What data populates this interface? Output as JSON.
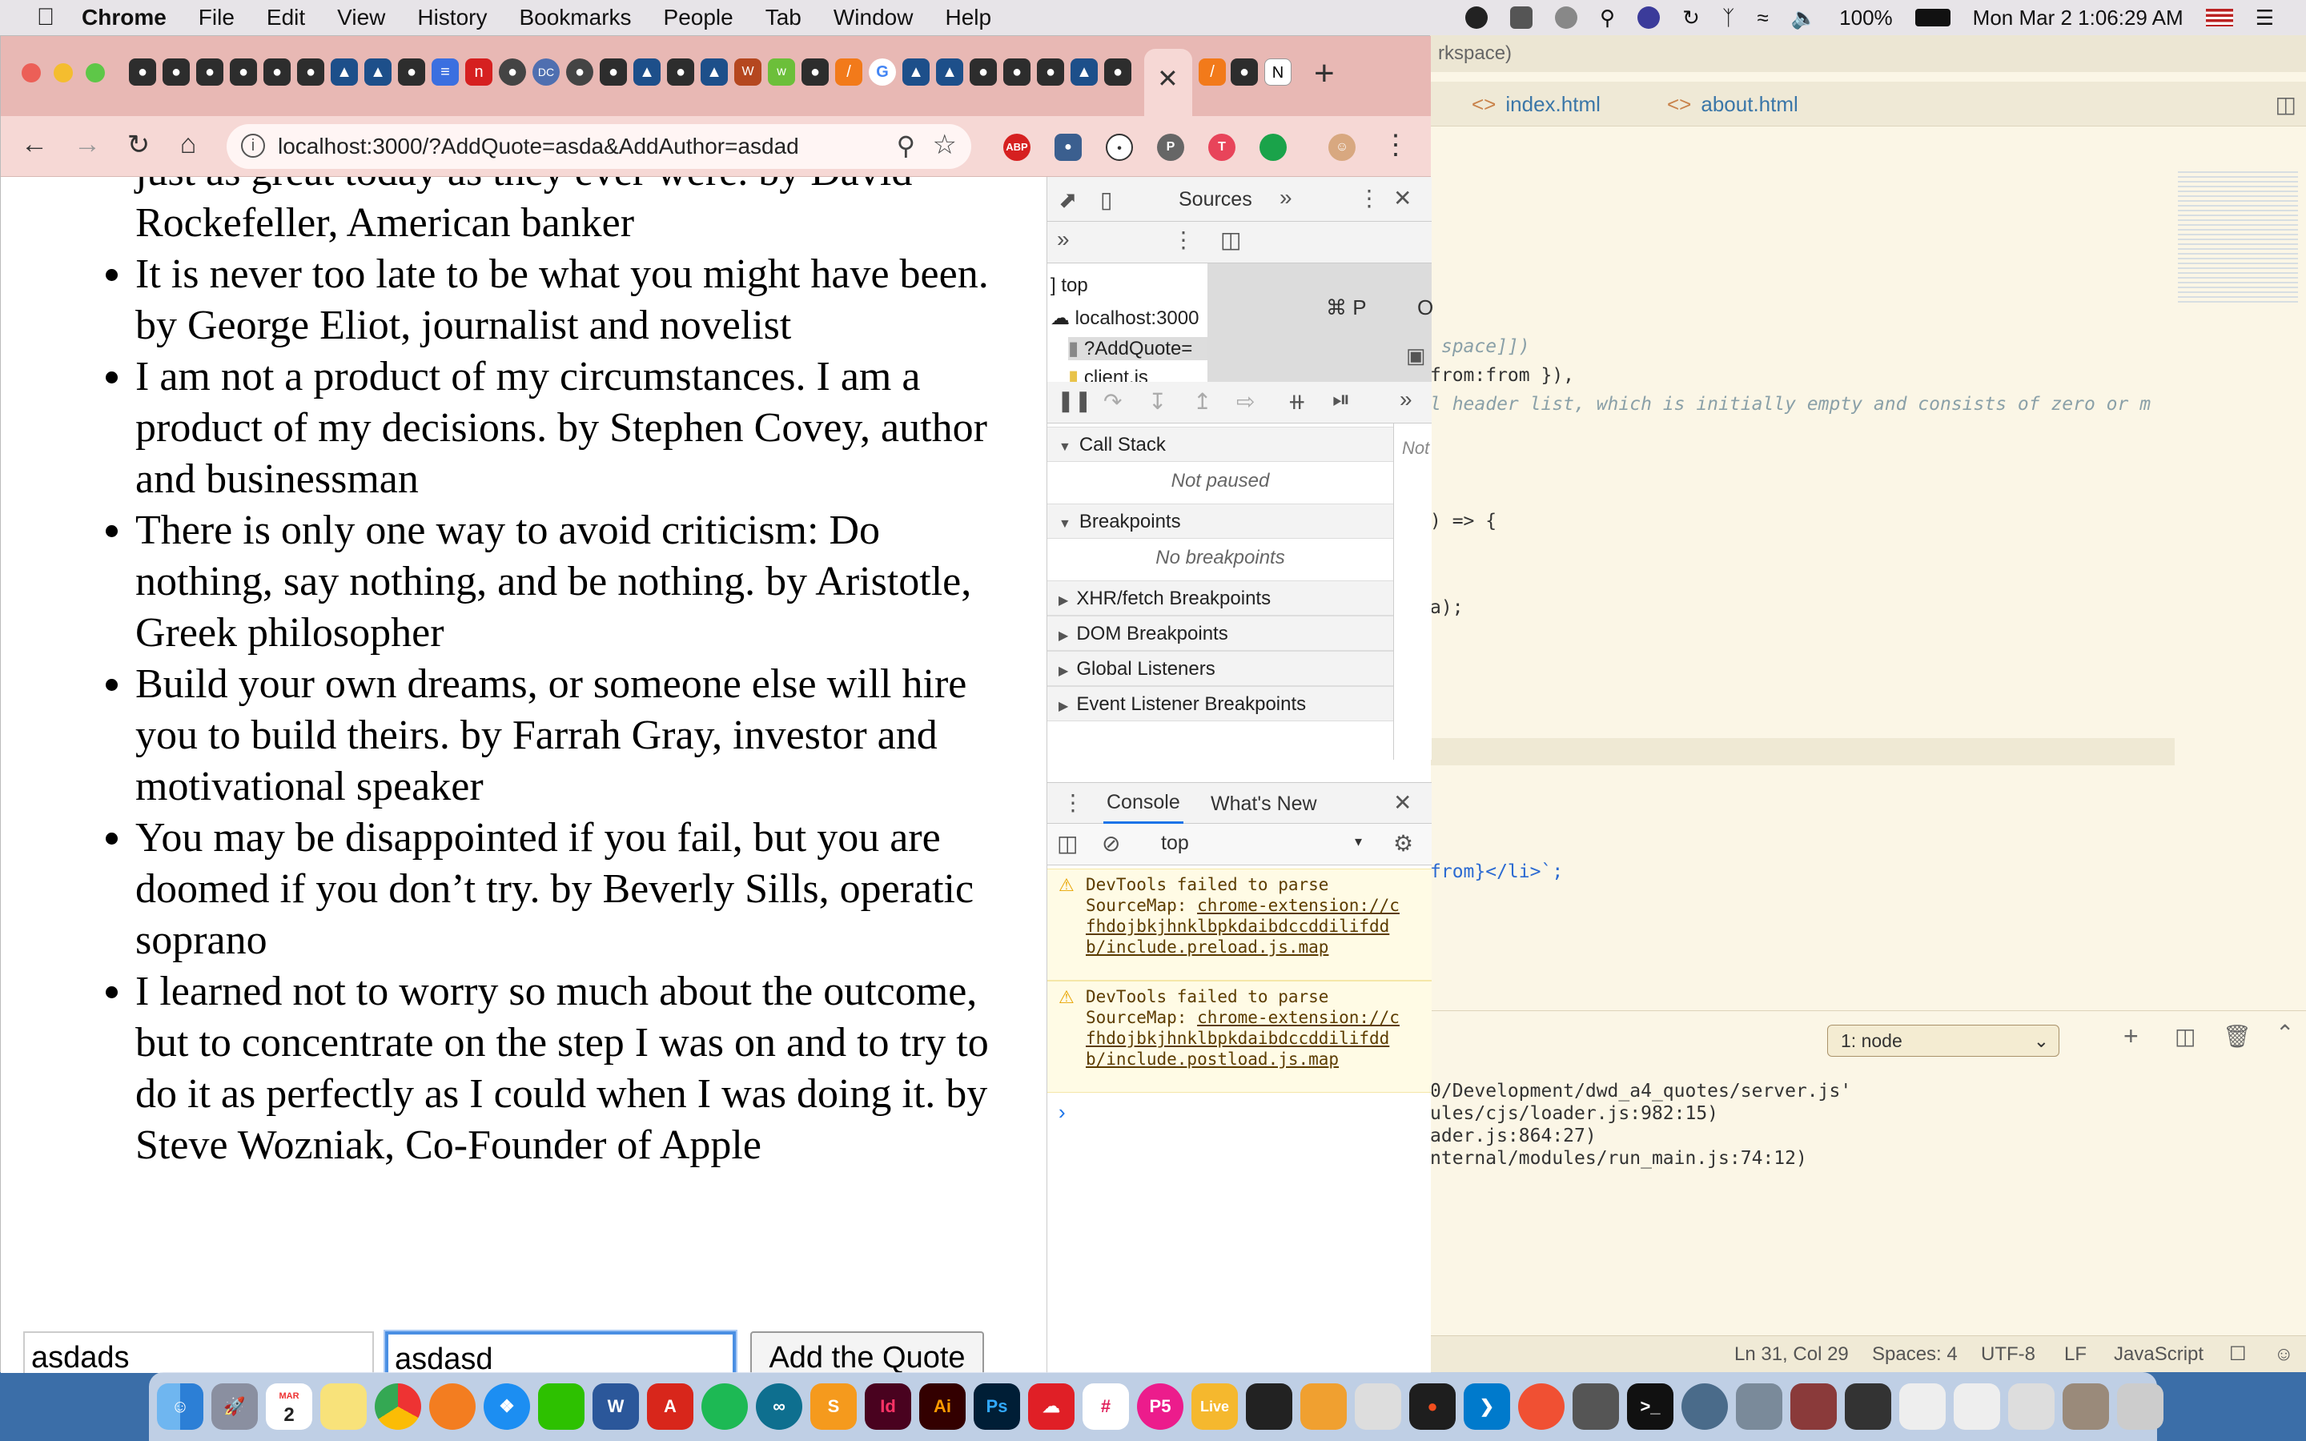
{
  "menubar": {
    "app": "Chrome",
    "items": [
      "File",
      "Edit",
      "View",
      "History",
      "Bookmarks",
      "People",
      "Tab",
      "Window",
      "Help"
    ],
    "battery": "100%",
    "clock": "Mon Mar 2  1:06:29 AM"
  },
  "browser": {
    "url": "localhost:3000/?AddQuote=asda&AddAuthor=asdad"
  },
  "page": {
    "partial_first_line": "just as great today as they ever were. by David Rockefeller, American banker",
    "quotes": [
      "It is never too late to be what you might have been. by George Eliot, journalist and novelist",
      "I am not a product of my circumstances. I am a product of my decisions. by Stephen Covey, author and businessman",
      "There is only one way to avoid criticism: Do nothing, say nothing, and be nothing. by Aristotle, Greek philosopher",
      "Build your own dreams, or someone else will hire you to build theirs. by Farrah Gray, investor and motivational speaker",
      "You may be disappointed if you fail, but you are doomed if you don’t try. by Beverly Sills, operatic soprano",
      "I learned not to worry so much about the outcome, but to concentrate on the step I was on and to try to do it as perfectly as I could when I was doing it. by Steve Wozniak, Co-Founder of Apple"
    ],
    "form": {
      "quote_value": "asdads",
      "author_value": "asdasd",
      "submit_label": "Add the Quote"
    }
  },
  "devtools": {
    "top_tab": "Sources",
    "nav": {
      "top": "top",
      "host": "localhost:3000",
      "file1": "?AddQuote=",
      "file2": "client.js",
      "shortcut": "⌘ P"
    },
    "call_stack": {
      "title": "Call Stack",
      "status": "Not paused"
    },
    "breakpoints": {
      "title": "Breakpoints",
      "status": "No breakpoints"
    },
    "collapsed_sections": [
      "XHR/fetch Breakpoints",
      "DOM Breakpoints",
      "Global Listeners",
      "Event Listener Breakpoints"
    ],
    "scope_partial": "Not",
    "console": {
      "tab_console": "Console",
      "tab_whatsnew": "What's New",
      "context": "top",
      "warnings": [
        {
          "prefix": "DevTools failed to parse SourceMap: ",
          "link": "chrome-extension://cfhdojbkjhnklbpkdaibdccddilifddb/include.preload.js.map"
        },
        {
          "prefix": "DevTools failed to parse SourceMap: ",
          "link": "chrome-extension://cfhdojbkjhnklbpkdaibdccddilifddb/include.postload.js.map"
        }
      ],
      "prompt": "›"
    }
  },
  "editor": {
    "window_title_partial": "rkspace)",
    "tabs": [
      "index.html",
      "about.html"
    ],
    "code_lines": [
      {
        "text": " space]])",
        "style": "comment"
      },
      {
        "text": "from:from }),",
        "style": "normal"
      },
      {
        "text": "l header list, which is initially empty and consists of zero or m",
        "style": "comment"
      },
      {
        "text": ") => {",
        "style": "normal"
      },
      {
        "text": "a);",
        "style": "normal"
      },
      {
        "text": "from}</li>`;",
        "style": "kw"
      }
    ],
    "terminal": {
      "selector": "1: node",
      "lines": [
        "0/Development/dwd_a4_quotes/server.js'",
        "ules/cjs/loader.js:982:15)",
        "ader.js:864:27)",
        "nternal/modules/run_main.js:74:12)"
      ]
    },
    "status": {
      "position": "Ln 31, Col 29",
      "spaces": "Spaces: 4",
      "encoding": "UTF-8",
      "eol": "LF",
      "language": "JavaScript"
    }
  },
  "dock": {
    "calendar_month": "MAR",
    "calendar_day": "2"
  },
  "colors": {
    "tabstrip": "#e8b8b4",
    "toolbar": "#f6d8d5",
    "focus_ring": "#4a8fe3",
    "devtools_accent": "#1a73e8",
    "editor_bg": "#fbf6e6"
  }
}
